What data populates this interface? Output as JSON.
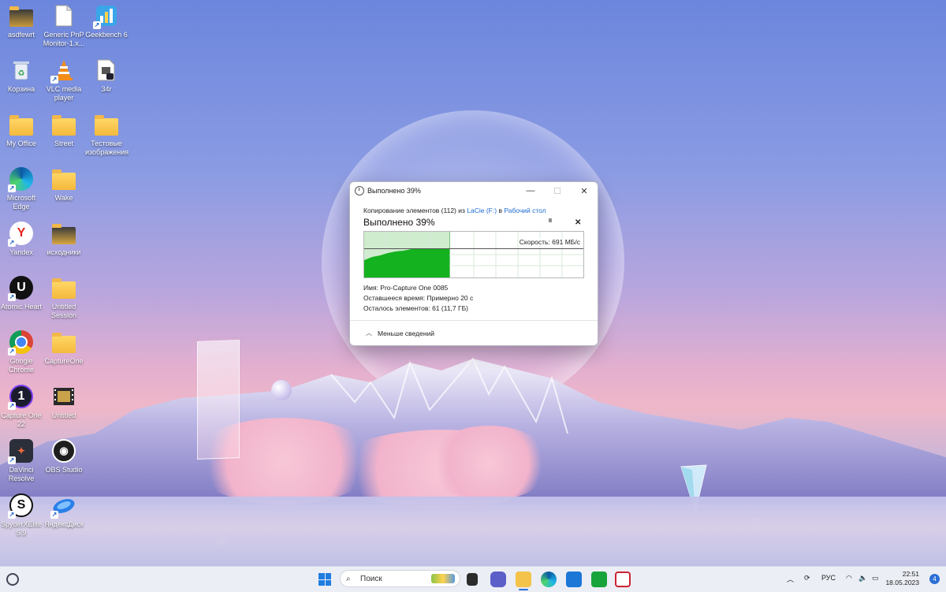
{
  "desktop": {
    "icons": [
      {
        "label": "asdfewrt"
      },
      {
        "label": "Generic PnP Monitor-1.x..."
      },
      {
        "label": "Geekbench 6"
      },
      {
        "label": "Корзина"
      },
      {
        "label": "VLC media player"
      },
      {
        "label": "34r"
      },
      {
        "label": "My Office"
      },
      {
        "label": "Street"
      },
      {
        "label": "Тестовые изображения"
      },
      {
        "label": "Microsoft Edge"
      },
      {
        "label": "Wake"
      },
      {
        "label": "Yandex"
      },
      {
        "label": "исходники"
      },
      {
        "label": "Atomic Heart"
      },
      {
        "label": "Untitled Session"
      },
      {
        "label": "Google Chrome"
      },
      {
        "label": "CaptureOne"
      },
      {
        "label": "Capture One 22"
      },
      {
        "label": "Untitled"
      },
      {
        "label": "DaVinci Resolve"
      },
      {
        "label": "OBS Studio"
      },
      {
        "label": "SpyderXElite 5.9"
      },
      {
        "label": "ЯндексДиск"
      }
    ]
  },
  "dialog": {
    "title": "Выполнено 39%",
    "copy_prefix": "Копирование элементов (112) из",
    "source": "LaCie (F:)",
    "middle": "в",
    "destination": "Рабочий стол",
    "heading": "Выполнено 39%",
    "pause_glyph": "II",
    "cancel_glyph": "✕",
    "progress_fraction": 0.39,
    "speed": "Скорость: 691 МБ/с",
    "name_line": "Имя:  Pro-Capture One 0085",
    "time_line": "Оставшееся время:  Примерно 20 с",
    "items_line": "Осталось элементов:  61 (11,7 ГБ)",
    "less_details": "Меньше сведений",
    "min_glyph": "—",
    "max_glyph": "☐",
    "close_glyph": "✕"
  },
  "taskbar": {
    "search_placeholder": "Поиск",
    "language": "РУС",
    "time": "22:51",
    "date": "18.05.2023",
    "notifications": "4"
  },
  "colors": {
    "accent": "#2b6fd6",
    "progress_green": "#14b21e",
    "progress_bg": "#cfeccf"
  }
}
